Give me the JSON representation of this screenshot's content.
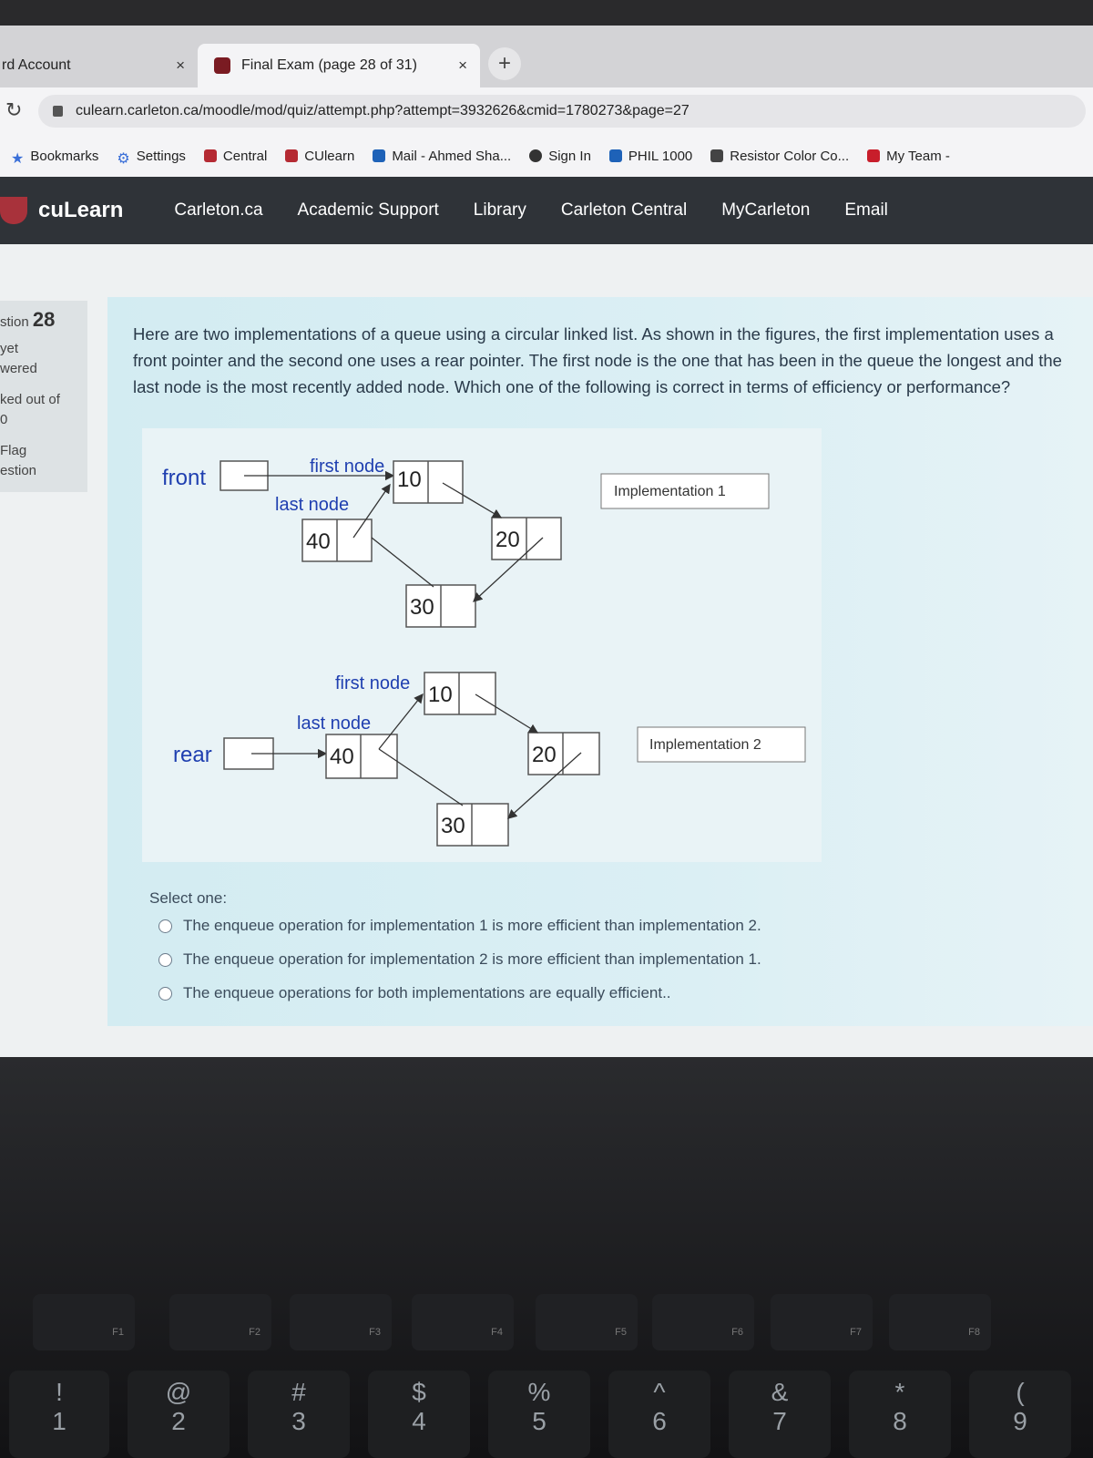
{
  "browser": {
    "tabs": [
      {
        "label": "rd Account",
        "close": "×"
      },
      {
        "label": "Final Exam (page 28 of 31)",
        "close": "×"
      }
    ],
    "new_tab": "+",
    "url": "culearn.carleton.ca/moodle/mod/quiz/attempt.php?attempt=3932626&cmid=1780273&page=27",
    "bookmarks": [
      "Bookmarks",
      "Settings",
      "Central",
      "CUlearn",
      "Mail - Ahmed Sha...",
      "Sign In",
      "PHIL 1000",
      "Resistor Color Co...",
      "My Team -"
    ]
  },
  "site": {
    "logo": "cuLearn",
    "nav": [
      "Carleton.ca",
      "Academic Support",
      "Library",
      "Carleton Central",
      "MyCarleton",
      "Email"
    ]
  },
  "sidebar": {
    "question_prefix": "stion",
    "question_number": "28",
    "status1": "yet",
    "status2": "wered",
    "marked": "ked out of",
    "marked_val": "0",
    "flag1": "Flag",
    "flag2": "estion"
  },
  "question": {
    "text": "Here are two implementations of a queue using a circular linked list. As shown in the figures, the first implementation uses a front pointer and the second one uses a rear pointer. The first node is the one that has been in the queue the longest and the last node is the most recently added node. Which one of the following is correct in terms of efficiency or performance?",
    "figure": {
      "impl1": {
        "label": "Implementation 1",
        "pointer": "front",
        "first_node": "first node",
        "last_node": "last node",
        "nodes": [
          "10",
          "20",
          "30",
          "40"
        ]
      },
      "impl2": {
        "label": "Implementation 2",
        "pointer": "rear",
        "first_node": "first node",
        "last_node": "last node",
        "nodes": [
          "10",
          "20",
          "30",
          "40"
        ]
      }
    },
    "select_one": "Select one:",
    "options": [
      "The enqueue operation for implementation 1 is more efficient than implementation 2.",
      "The enqueue operation for implementation 2 is more efficient than implementation 1.",
      "The enqueue operations for both implementations are equally efficient.."
    ]
  },
  "keyboard": {
    "fkeys": [
      "F1",
      "F2",
      "F3",
      "F4",
      "F5",
      "F6",
      "F7",
      "F8"
    ],
    "numkeys": [
      "1",
      "2",
      "3",
      "4",
      "5",
      "6",
      "7",
      "8",
      "9"
    ],
    "symbols": [
      "!",
      "@",
      "#",
      "$",
      "%",
      "^",
      "&",
      "*",
      "("
    ]
  }
}
